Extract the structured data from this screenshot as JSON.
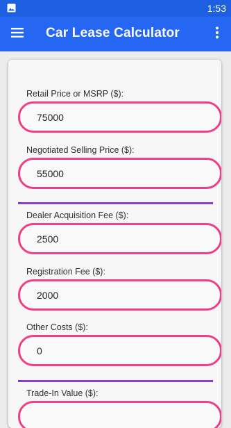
{
  "status_bar": {
    "time": "1:53",
    "icons": [
      "image-icon"
    ]
  },
  "app_bar": {
    "title": "Car Lease Calculator",
    "icons": [
      "menu-icon",
      "more-vert-icon"
    ],
    "color": "#2566f3"
  },
  "form": {
    "fields": [
      {
        "label": "Retail Price or MSRP ($):",
        "value": "75000"
      },
      {
        "label": "Negotiated Selling Price ($):",
        "value": "55000"
      },
      {
        "label": "Dealer Acquisition Fee ($):",
        "value": "2500"
      },
      {
        "label": "Registration Fee ($):",
        "value": "2000"
      },
      {
        "label": "Other Costs ($):",
        "value": "0"
      },
      {
        "label": "Trade-In Value ($):",
        "value": ""
      }
    ],
    "input_border_color": "#ef3f86",
    "divider_color": "#8a3ad9"
  }
}
